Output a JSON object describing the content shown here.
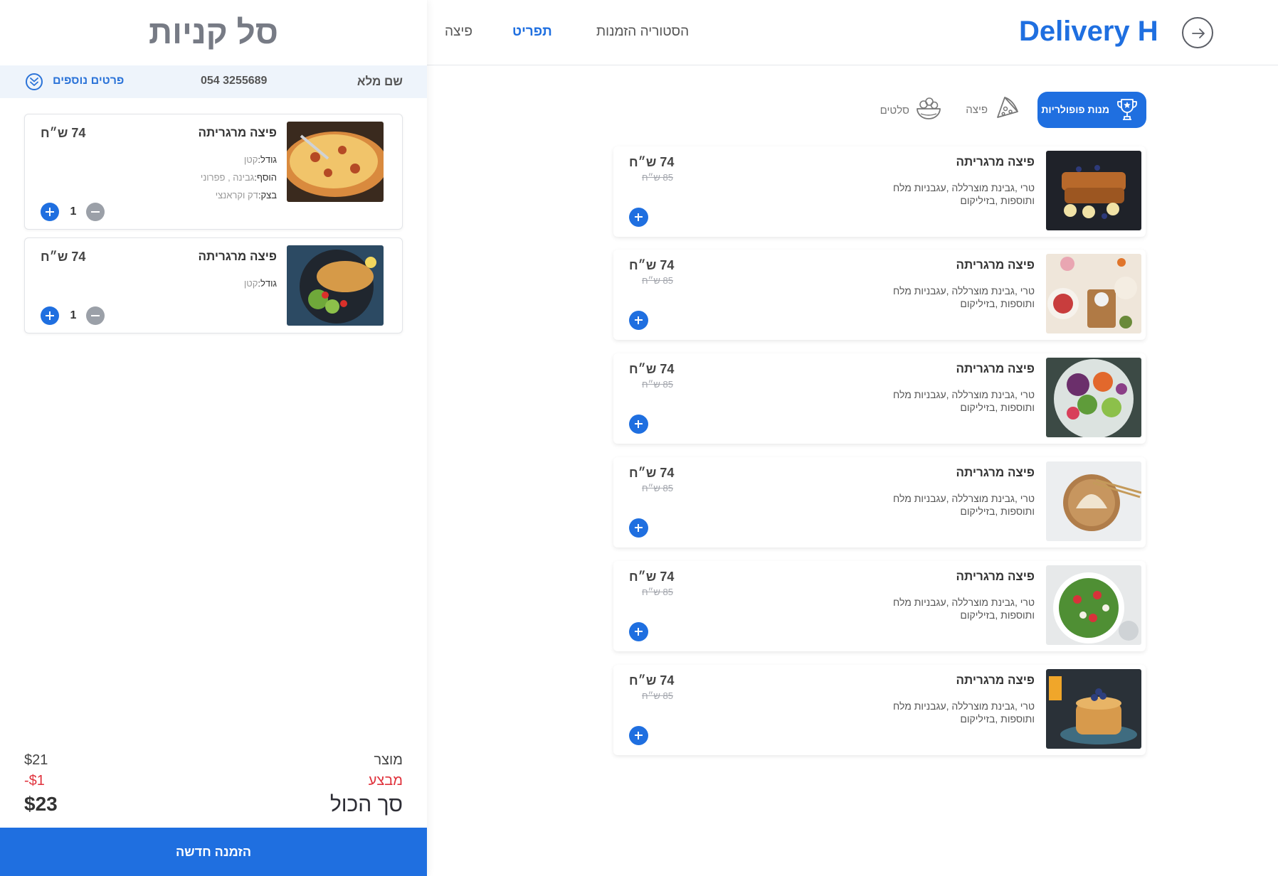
{
  "header": {
    "brand": "Delivery H",
    "nav": [
      "פיצה",
      "תפריט",
      "הסטוריה הזמנות"
    ],
    "back_icon": "arrow-right-circle-icon"
  },
  "categories": [
    {
      "label": "מנות פופולריות",
      "icon": "trophy-icon",
      "active": true
    },
    {
      "label": "פיצה",
      "icon": "pizza-slice-icon",
      "active": false
    },
    {
      "label": "סלטים",
      "icon": "salad-bowl-icon",
      "active": false
    }
  ],
  "menu": {
    "items": [
      {
        "title": "פיצה מרגריתה",
        "desc": "טרי ,גבינת מוצרללה ,עגבניות מלח ותוספות ,בזיליקום",
        "price": "74 ש״ח",
        "old_price": "85 ש״ח"
      },
      {
        "title": "פיצה מרגריתה",
        "desc": "טרי ,גבינת מוצרללה ,עגבניות מלח ותוספות ,בזיליקום",
        "price": "74 ש״ח",
        "old_price": "85 ש״ח"
      },
      {
        "title": "פיצה מרגריתה",
        "desc": "טרי ,גבינת מוצרללה ,עגבניות מלח ותוספות ,בזיליקום",
        "price": "74 ש״ח",
        "old_price": "85 ש״ח"
      },
      {
        "title": "פיצה מרגריתה",
        "desc": "טרי ,גבינת מוצרללה ,עגבניות מלח ותוספות ,בזיליקום",
        "price": "74 ש״ח",
        "old_price": "85 ש״ח"
      },
      {
        "title": "פיצה מרגריתה",
        "desc": "טרי ,גבינת מוצרללה ,עגבניות מלח ותוספות ,בזיליקום",
        "price": "74 ש״ח",
        "old_price": "85 ש״ח"
      },
      {
        "title": "פיצה מרגריתה",
        "desc": "טרי ,גבינת מוצרללה ,עגבניות מלח ותוספות ,בזיליקום",
        "price": "74 ש״ח",
        "old_price": "85 ש״ח"
      }
    ]
  },
  "cart": {
    "title": "סל קניות",
    "customer": {
      "name_label": "שם מלא",
      "phone": "054 3255689",
      "more_label": "פרטים נוספים"
    },
    "items": [
      {
        "title": "פיצה מרגריתה",
        "price": "74 ש״ח",
        "size_label": "גודל:",
        "size_value": "קטן",
        "extra_label": "הוסף:",
        "extra_value": "גבינה , פפרוני",
        "dough_label": "בצק:",
        "dough_value": "דק וקראנצי",
        "qty": "1"
      },
      {
        "title": "פיצה מרגריתה",
        "price": "74 ש״ח",
        "size_label": "גודל:",
        "size_value": "קטן",
        "qty": "1"
      }
    ],
    "totals": {
      "subtotal_label": "מוצר",
      "subtotal_value": "$21",
      "discount_label": "מבצע",
      "discount_value": "-$1",
      "total_label": "סך הכול",
      "total_value": "$23"
    },
    "new_order_label": "הזמנה חדשה"
  },
  "colors": {
    "accent": "#1f6fe0",
    "discount": "#e0323c",
    "muted": "#9ba0a8"
  }
}
